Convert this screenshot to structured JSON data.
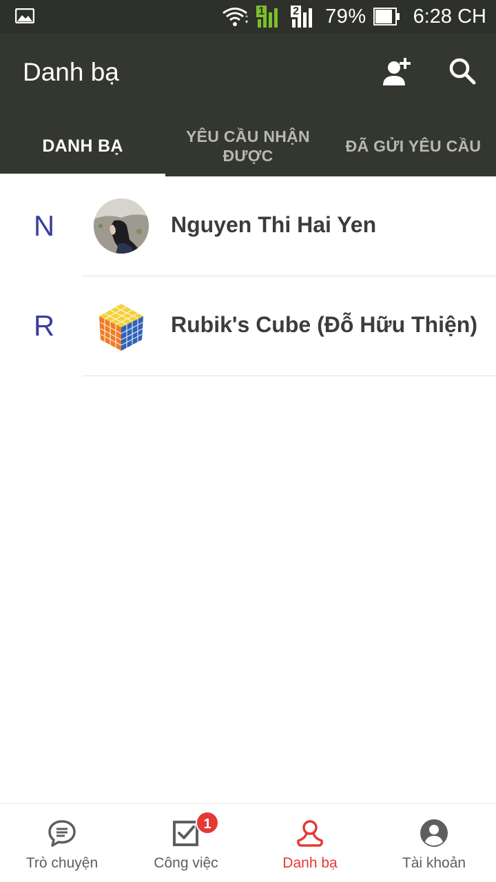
{
  "status_bar": {
    "left_icon": "gallery-icon",
    "sim1": "1",
    "sim2": "2",
    "battery": "79%",
    "time": "6:28 CH"
  },
  "app_bar": {
    "title": "Danh bạ",
    "actions": [
      "add-contact-icon",
      "search-icon"
    ]
  },
  "tabs": [
    {
      "label": "DANH BẠ",
      "active": true
    },
    {
      "label": "YÊU CẦU NHẬN ĐƯỢC",
      "active": false
    },
    {
      "label": "ĐÃ GỬI YÊU CẦU",
      "active": false
    }
  ],
  "contacts": [
    {
      "letter": "N",
      "name": "Nguyen Thi Hai Yen",
      "avatar": "photo"
    },
    {
      "letter": "R",
      "name": "Rubik's Cube (Đỗ Hữu Thiện)",
      "avatar": "rubik-cube"
    }
  ],
  "bottom_nav": [
    {
      "label": "Trò chuyện",
      "icon": "chat-icon",
      "active": false
    },
    {
      "label": "Công việc",
      "icon": "task-check-icon",
      "active": false,
      "badge": "1"
    },
    {
      "label": "Danh bạ",
      "icon": "contacts-person-icon",
      "active": true
    },
    {
      "label": "Tài khoản",
      "icon": "account-icon",
      "active": false
    }
  ],
  "colors": {
    "status_bar": "#2e302b",
    "app_bar": "#34372f",
    "letter": "#3a3d9e",
    "accent": "#e53935"
  }
}
